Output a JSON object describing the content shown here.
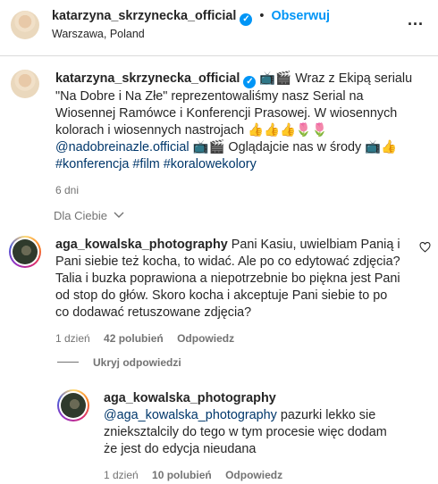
{
  "header": {
    "username": "katarzyna_skrzynecka_official",
    "dot": "•",
    "follow": "Obserwuj",
    "location": "Warszawa, Poland",
    "more": "..."
  },
  "caption": {
    "username": "katarzyna_skrzynecka_official",
    "line1_after_user": "📺🎬 Wraz z Ekipą serialu",
    "line2": "\"Na Dobre i Na Złe\" reprezentowaliśmy nasz Serial na",
    "line3": "Wiosennej Ramówce i Konferencji Prasowej. W wiosennych",
    "line4": "kolorach i wiosennych nastrojach 👍👍👍🌷🌷",
    "mention": "@nadobreinazle.official",
    "line5_after_mention": " 📺🎬 Oglądajcie nas w środy 📺👍",
    "hashtags": "#konferencja #film #koralowekolory",
    "time": "6 dni"
  },
  "filter": {
    "label": "Dla Ciebie"
  },
  "comment1": {
    "username": "aga_kowalska_photography",
    "line1_after_user": " Pani Kasiu, uwielbiam Panią i",
    "line2": "Pani siebie też kocha, to widać. Ale po co edytować zdjęcia?",
    "line3": "Talia i buzka poprawiona a niepotrzebnie bo piękna jest Pani",
    "line4": "od stop do głów. Skoro kocha i akceptuje Pani siebie to po",
    "line5": "co dodawać retuszowane zdjęcia?",
    "time": "1 dzień",
    "likes": "42 polubień",
    "reply": "Odpowiedz"
  },
  "replies_toggle": {
    "label": "Ukryj odpowiedzi"
  },
  "reply1": {
    "username": "aga_kowalska_photography",
    "mention": "@aga_kowalska_photography",
    "line1_after_mention": " pazurki lekko sie",
    "line2": "znieksztalcily do tego w tym procesie więc dodam",
    "line3": "że jest do edycja nieudana",
    "time": "1 dzień",
    "likes": "10 polubień",
    "reply": "Odpowiedz"
  },
  "icons": {
    "verified": "verified-badge-icon",
    "heart": "heart-icon",
    "chevron": "chevron-down-icon",
    "more": "more-options-icon"
  },
  "colors": {
    "link": "#00376b",
    "follow": "#0095f6",
    "muted": "#737373",
    "verified": "#0095f6"
  }
}
